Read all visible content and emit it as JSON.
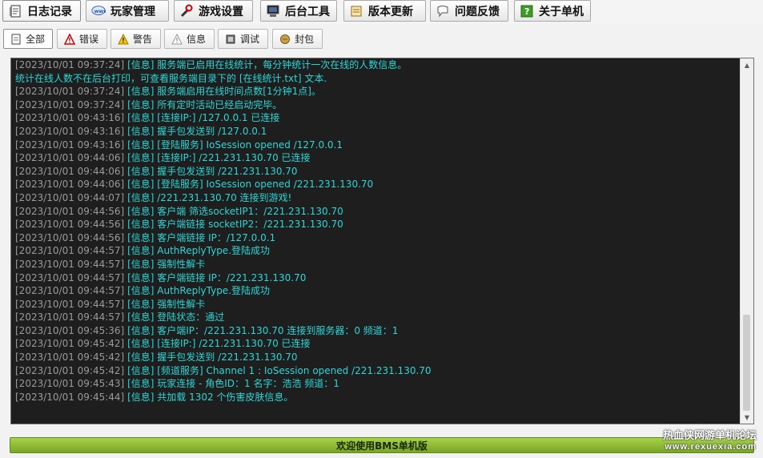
{
  "toolbar": {
    "buttons": [
      {
        "label": "日志记录",
        "icon": "notepad-icon"
      },
      {
        "label": "玩家管理",
        "icon": "monitor-icon"
      },
      {
        "label": "游戏设置",
        "icon": "tools-icon"
      },
      {
        "label": "后台工具",
        "icon": "computer-icon"
      },
      {
        "label": "版本更新",
        "icon": "scroll-icon"
      },
      {
        "label": "问题反馈",
        "icon": "chat-icon"
      },
      {
        "label": "关于单机",
        "icon": "help-icon"
      }
    ]
  },
  "filters": {
    "tabs": [
      {
        "label": "全部",
        "icon": "document-icon"
      },
      {
        "label": "错误",
        "icon": "error-triangle-icon"
      },
      {
        "label": "警告",
        "icon": "warning-icon"
      },
      {
        "label": "信息",
        "icon": "info-icon"
      },
      {
        "label": "调试",
        "icon": "debug-icon"
      },
      {
        "label": "封包",
        "icon": "packet-icon"
      }
    ]
  },
  "log": {
    "lines": [
      {
        "ts": "[2023/10/01 09:37:24]",
        "lv": "[信息]",
        "msg": " 服务端已启用在线统计，每分钟统计一次在线的人数信息。"
      },
      {
        "ts": "",
        "lv": "",
        "msg": "统计在线人数不在后台打印，可查看服务端目录下的 [在线统计.txt] 文本."
      },
      {
        "ts": "[2023/10/01 09:37:24]",
        "lv": "[信息]",
        "msg": " 服务端启用在线时间点数[1分钟1点]。"
      },
      {
        "ts": "[2023/10/01 09:37:24]",
        "lv": "[信息]",
        "msg": " 所有定时活动已经启动完毕。"
      },
      {
        "ts": "[2023/10/01 09:43:16]",
        "lv": "[信息]",
        "msg": " [连接IP:] /127.0.0.1 已连接"
      },
      {
        "ts": "[2023/10/01 09:43:16]",
        "lv": "[信息]",
        "msg": " 握手包发送到 /127.0.0.1"
      },
      {
        "ts": "[2023/10/01 09:43:16]",
        "lv": "[信息]",
        "msg": " [登陆服务] IoSession opened /127.0.0.1"
      },
      {
        "ts": "[2023/10/01 09:44:06]",
        "lv": "[信息]",
        "msg": " [连接IP:] /221.231.130.70 已连接"
      },
      {
        "ts": "[2023/10/01 09:44:06]",
        "lv": "[信息]",
        "msg": " 握手包发送到 /221.231.130.70"
      },
      {
        "ts": "[2023/10/01 09:44:06]",
        "lv": "[信息]",
        "msg": " [登陆服务] IoSession opened /221.231.130.70"
      },
      {
        "ts": "[2023/10/01 09:44:07]",
        "lv": "[信息]",
        "msg": " /221.231.130.70 连接到游戏!"
      },
      {
        "ts": "[2023/10/01 09:44:56]",
        "lv": "[信息]",
        "msg": " 客户端 筛选socketIP1：/221.231.130.70"
      },
      {
        "ts": "[2023/10/01 09:44:56]",
        "lv": "[信息]",
        "msg": " 客户端链接 socketIP2：/221.231.130.70"
      },
      {
        "ts": "[2023/10/01 09:44:56]",
        "lv": "[信息]",
        "msg": " 客户端链接 IP：/127.0.0.1"
      },
      {
        "ts": "[2023/10/01 09:44:57]",
        "lv": "[信息]",
        "msg": " AuthReplyType.登陆成功"
      },
      {
        "ts": "[2023/10/01 09:44:57]",
        "lv": "[信息]",
        "msg": " 强制性解卡"
      },
      {
        "ts": "[2023/10/01 09:44:57]",
        "lv": "[信息]",
        "msg": " 客户端链接 IP：/221.231.130.70"
      },
      {
        "ts": "[2023/10/01 09:44:57]",
        "lv": "[信息]",
        "msg": " AuthReplyType.登陆成功"
      },
      {
        "ts": "[2023/10/01 09:44:57]",
        "lv": "[信息]",
        "msg": " 强制性解卡"
      },
      {
        "ts": "[2023/10/01 09:44:57]",
        "lv": "[信息]",
        "msg": " 登陆状态：通过"
      },
      {
        "ts": "[2023/10/01 09:45:36]",
        "lv": "[信息]",
        "msg": " 客户端IP：/221.231.130.70 连接到服务器：0 频道：1"
      },
      {
        "ts": "[2023/10/01 09:45:42]",
        "lv": "[信息]",
        "msg": " [连接IP:] /221.231.130.70 已连接"
      },
      {
        "ts": "[2023/10/01 09:45:42]",
        "lv": "[信息]",
        "msg": " 握手包发送到 /221.231.130.70"
      },
      {
        "ts": "[2023/10/01 09:45:42]",
        "lv": "[信息]",
        "msg": " [频道服务] Channel 1 : IoSession opened /221.231.130.70"
      },
      {
        "ts": "[2023/10/01 09:45:43]",
        "lv": "[信息]",
        "msg": " 玩家连接 - 角色ID：1 名字：浩浩 频道：1"
      },
      {
        "ts": "[2023/10/01 09:45:44]",
        "lv": "[信息]",
        "msg": " 共加载 1302 个伤害皮肤信息。"
      }
    ]
  },
  "status": {
    "text": "欢迎使用BMS单机版"
  },
  "watermark": {
    "line1": "热血侠网游单机论坛",
    "line2": "www.rexuexia.com"
  },
  "colors": {
    "log_bg": "#1e1e1e",
    "log_text": "#2bd6d6",
    "timestamp": "#9a9a9a",
    "status_bar": "#8fbc3a"
  }
}
